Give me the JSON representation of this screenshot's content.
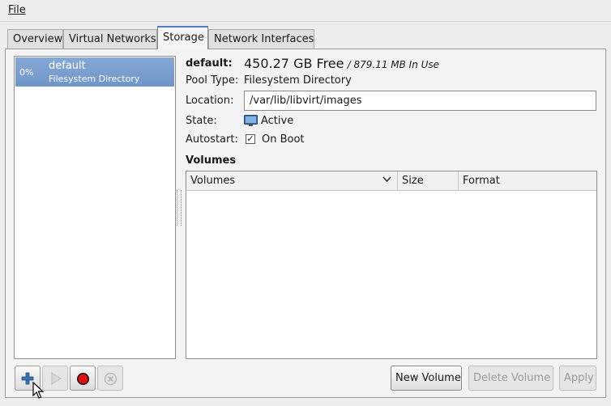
{
  "menubar": {
    "file": "File"
  },
  "tabs": [
    {
      "label": "Overview"
    },
    {
      "label": "Virtual Networks"
    },
    {
      "label": "Storage"
    },
    {
      "label": "Network Interfaces"
    }
  ],
  "pools": [
    {
      "percent": "0%",
      "name": "default",
      "type": "Filesystem Directory"
    }
  ],
  "details": {
    "name": "default:",
    "free": "450.27 GB Free",
    "in_use": "/ 879.11 MB In Use",
    "pool_type_label": "Pool Type:",
    "pool_type": "Filesystem Directory",
    "location_label": "Location:",
    "location": "/var/lib/libvirt/images",
    "state_label": "State:",
    "state": "Active",
    "autostart_label": "Autostart:",
    "autostart": "On Boot",
    "autostart_checked": true
  },
  "volumes": {
    "heading": "Volumes",
    "columns": [
      "Volumes",
      "Size",
      "Format"
    ],
    "rows": []
  },
  "buttons": {
    "new_volume": "New Volume",
    "delete_volume": "Delete Volume",
    "apply": "Apply"
  },
  "icons": {
    "add_pool": "plus-icon",
    "start_pool": "play-icon",
    "stop_pool": "stop-record-icon",
    "delete_pool": "delete-circle-icon",
    "state": "monitor-icon",
    "cursor": "mouse-pointer-icon"
  }
}
